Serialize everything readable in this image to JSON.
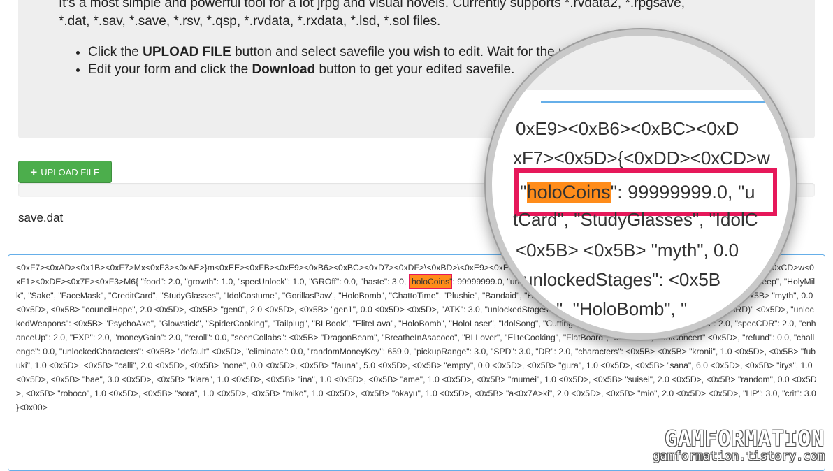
{
  "info": {
    "intro_line1": "It's a most simple and powerful tool for a lot jrpg and visual novels. Currently supports *.rvdata2, *.rpgsave,",
    "intro_line2": "*.dat, *.sav, *.save, *.rsv, *.qsp, *.rvdata, *.rxdata, *.lsd, *.sol files.",
    "step1_pre": "Click the ",
    "step1_bold": "UPLOAD FILE",
    "step1_post": " button and select savefile you wish to edit. Wait for the upload process to finish.",
    "step2_pre": "Edit your form and click the ",
    "step2_bold": "Download",
    "step2_post": " button to get your edited savefile."
  },
  "upload": {
    "icon": "plus-icon",
    "label": "UPLOAD FILE"
  },
  "file": {
    "name": "save.dat"
  },
  "editor": {
    "before": "<0xF7><0xAD><0x1B><0xF7>Mx<0xF3><0xAE>}m<0xEE><0xFB><0xE9><0xB6><0xBC><0xD7><0xDF>\\<0xBD>\\<0xE9><0xE6><0xFB>q<0xDD><0xF8><0xF3>f<0xB9><0xE7><0x5D>{<0xDD><0xCD>w<0xF1><0xDE><0x7F><0xF3>M6{ \"food\": 2.0, \"growth\": 1.0, \"specUnlock\": 1.0, \"GROff\": 0.0, \"haste\": 3.0, \"",
    "highlight": "holoCoins",
    "after": "\": 99999999.0, \"unlockedItems\": <0x5B> \"SuccubusHorn\", \"Headphones\", \"UberSheep\", \"HolyMilk\", \"Sake\", \"FaceMask\", \"CreditCard\", \"StudyGlasses\", \"IdolCostume\", \"GorillasPaw\", \"HoloBomb\", \"ChattoTime\", \"Plushie\", \"Bandaid\", \"Halu\", \"PiggyBank\", \"GWSPill\" <0x5D>, \"tears\": <0x5B> <0x5B> \"myth\", 0.0 <0x5D>, <0x5B> \"councilHope\", 2.0 <0x5D>, <0x5B> \"gen0\", 2.0 <0x5D>, <0x5B> \"gen1\", 0.0 <0x5D> <0x5D>, \"ATK\": 3.0, \"unlockedStages\": <0x5B> \"STAGE 1\", \"STAGE 2\", \"STAGE 1 (HARD)\" <0x5D>, \"unlockedWeapons\": <0x5B> \"PsychoAxe\", \"Glowstick\", \"SpiderCooking\", \"Tailplug\", \"BLBook\", \"EliteLava\", \"HoloBomb\", \"HoloLaser\", \"IdolSong\", \"CuttingBoard\", \"CEOTears\" <0x5D>, \"regen\": 2.0, \"specCDR\": 2.0, \"enhanceUp\": 2.0, \"EXP\": 2.0, \"moneyGain\": 2.0, \"reroll\": 0.0, \"seenCollabs\": <0x5B> \"DragonBeam\", \"BreatheInAsacoco\", \"BLLover\", \"EliteCooking\", \"FlatBoard\", \"MiComet\", \"IdolConcert\" <0x5D>, \"refund\": 0.0, \"challenge\": 0.0, \"unlockedCharacters\": <0x5B> \"default\" <0x5D>, \"eliminate\": 0.0, \"randomMoneyKey\": 659.0, \"pickupRange\": 3.0, \"SPD\": 3.0, \"DR\": 2.0, \"characters\": <0x5B> <0x5B> \"kronii\", 1.0 <0x5D>, <0x5B> \"fubuki\", 1.0 <0x5D>, <0x5B> \"calli\", 2.0 <0x5D>, <0x5B> \"none\", 0.0 <0x5D>, <0x5B> \"fauna\", 5.0 <0x5D>, <0x5B> \"empty\", 0.0 <0x5D>, <0x5B> \"gura\", 1.0 <0x5D>, <0x5B> \"sana\", 6.0 <0x5D>, <0x5B> \"irys\", 1.0 <0x5D>, <0x5B> \"bae\", 3.0 <0x5D>, <0x5B> \"kiara\", 1.0 <0x5D>, <0x5B> \"ina\", 1.0 <0x5D>, <0x5B> \"ame\", 1.0 <0x5D>, <0x5B> \"mumei\", 1.0 <0x5D>, <0x5B> \"suisei\", 2.0 <0x5D>, <0x5B> \"random\", 0.0 <0x5D>, <0x5B> \"roboco\", 1.0 <0x5D>, <0x5B> \"sora\", 1.0 <0x5D>, <0x5B> \"miko\", 1.0 <0x5D>, <0x5B> \"okayu\", 1.0 <0x5D>, <0x5B> \"a<0x7A>ki\", 2.0 <0x5D>, <0x5B> \"mio\", 2.0 <0x5D> <0x5D>, \"HP\": 3.0, \"crit\": 3.0 }<0x00>"
  },
  "magnifier": {
    "line1": "0xE9><0xB6><0xBC><0xD",
    "line2": "xF7><0x5D>{<0xDD><0xCD>w",
    "hl_key": "holoCoins",
    "hl_value": "\": 99999999.0, \"u",
    "line4": "tCard\", \"StudyGlasses\", \"IdolC",
    "line5": "<0x5B> <0x5B> \"myth\", 0.0",
    "line6": "unlockedStages\": <0x5B",
    "line7": "\", \"HoloBomb\", \""
  },
  "watermark": {
    "brand": "GAMFORMATION",
    "url": "gamformation.tistory.com"
  }
}
